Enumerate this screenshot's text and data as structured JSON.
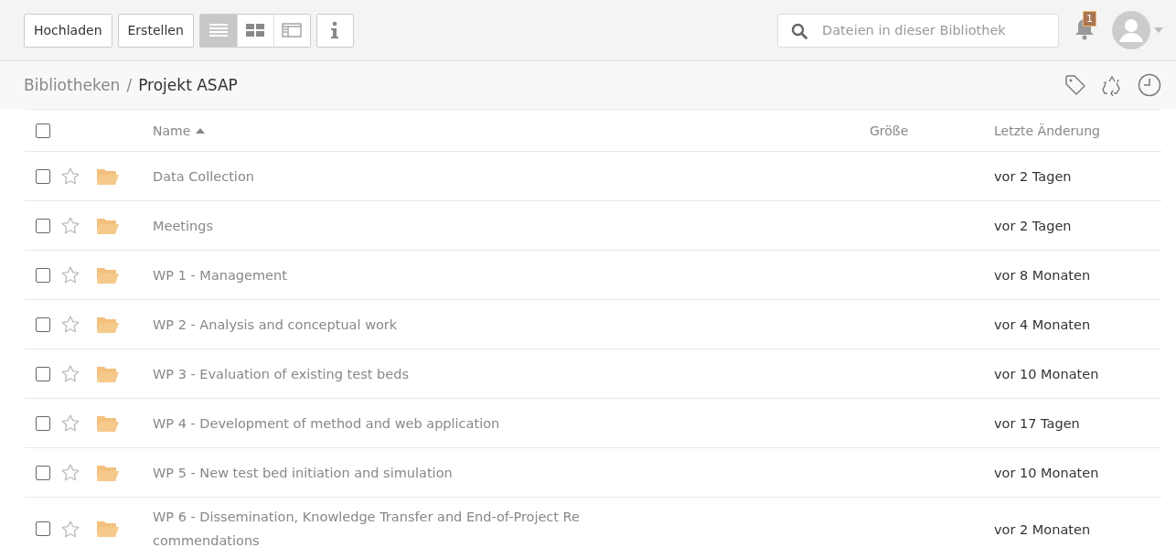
{
  "toolbar": {
    "buttons": [
      "Hochladen",
      "Erstellen"
    ],
    "view_modes": [
      {
        "kind": "list",
        "selected": true
      },
      {
        "kind": "grid",
        "selected": false
      },
      {
        "kind": "columns",
        "selected": false
      }
    ]
  },
  "search": {
    "placeholder": "Dateien in dieser Bibliothek"
  },
  "notifications": {
    "count": "1"
  },
  "breadcrumb": {
    "parent": "Bibliotheken",
    "separator": "/",
    "current": "Projekt ASAP"
  },
  "table": {
    "columns": [
      "Name",
      "Größe",
      "Letzte Änderung"
    ],
    "all_checked": false,
    "rows": [
      {
        "name": "Data Collection",
        "modified": "vor 2 Tagen",
        "checked": false,
        "starred": false
      },
      {
        "name": "Meetings",
        "modified": "vor 2 Tagen",
        "checked": false,
        "starred": false
      },
      {
        "name": "WP 1 - Management",
        "modified": "vor 8 Monaten",
        "checked": false,
        "starred": false
      },
      {
        "name": "WP 2 - Analysis and conceptual work",
        "modified": "vor 4 Monaten",
        "checked": false,
        "starred": false
      },
      {
        "name": "WP 3 - Evaluation of existing test beds",
        "modified": "vor 10 Monaten",
        "checked": false,
        "starred": false
      },
      {
        "name": "WP 4 - Development of method and web application",
        "modified": "vor 17 Tagen",
        "checked": false,
        "starred": false
      },
      {
        "name": "WP 5 - New test bed initiation and simulation",
        "modified": "vor 10 Monaten",
        "checked": false,
        "starred": false
      },
      {
        "name": "WP 6 - Dissemination, Knowledge Transfer and End-of-Project Recommendations",
        "modified": "vor 2 Monaten",
        "checked": false,
        "starred": false
      }
    ]
  }
}
